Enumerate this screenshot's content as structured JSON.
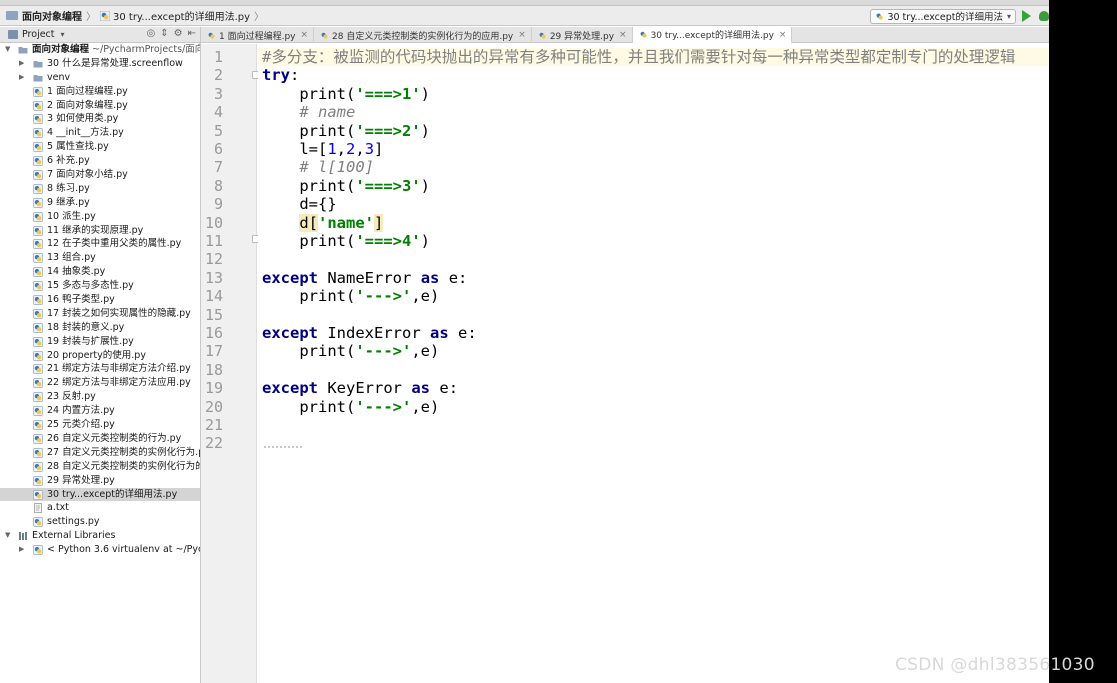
{
  "navbar": {
    "project": "面向对象编程",
    "file": "30 try...except的详细用法.py",
    "run_config": "30 try...except的详细用法"
  },
  "sidebar": {
    "header": "Project",
    "root": {
      "name": "面向对象编程",
      "path": "~/PycharmProjects/面向"
    },
    "items": [
      {
        "label": "30 什么是异常处理.screenflow",
        "kind": "folder"
      },
      {
        "label": "venv",
        "kind": "folder"
      },
      {
        "label": "1 面向过程编程.py",
        "kind": "py"
      },
      {
        "label": "2 面向对象编程.py",
        "kind": "py"
      },
      {
        "label": "3 如何使用类.py",
        "kind": "py"
      },
      {
        "label": "4 __init__方法.py",
        "kind": "py"
      },
      {
        "label": "5 属性查找.py",
        "kind": "py"
      },
      {
        "label": "6 补充.py",
        "kind": "py"
      },
      {
        "label": "7 面向对象小结.py",
        "kind": "py"
      },
      {
        "label": "8 练习.py",
        "kind": "py"
      },
      {
        "label": "9 继承.py",
        "kind": "py"
      },
      {
        "label": "10 派生.py",
        "kind": "py"
      },
      {
        "label": "11 继承的实现原理.py",
        "kind": "py"
      },
      {
        "label": "12 在子类中重用父类的属性.py",
        "kind": "py"
      },
      {
        "label": "13 组合.py",
        "kind": "py"
      },
      {
        "label": "14 抽象类.py",
        "kind": "py"
      },
      {
        "label": "15 多态与多态性.py",
        "kind": "py"
      },
      {
        "label": "16 鸭子类型.py",
        "kind": "py"
      },
      {
        "label": "17 封装之如何实现属性的隐藏.py",
        "kind": "py"
      },
      {
        "label": "18 封装的意义.py",
        "kind": "py"
      },
      {
        "label": "19 封装与扩展性.py",
        "kind": "py"
      },
      {
        "label": "20 property的使用.py",
        "kind": "py"
      },
      {
        "label": "21 绑定方法与非绑定方法介绍.py",
        "kind": "py"
      },
      {
        "label": "22 绑定方法与非绑定方法应用.py",
        "kind": "py"
      },
      {
        "label": "23 反射.py",
        "kind": "py"
      },
      {
        "label": "24 内置方法.py",
        "kind": "py"
      },
      {
        "label": "25 元类介绍.py",
        "kind": "py"
      },
      {
        "label": "26 自定义元类控制类的行为.py",
        "kind": "py"
      },
      {
        "label": "27 自定义元类控制类的实例化行为.p",
        "kind": "py"
      },
      {
        "label": "28 自定义元类控制类的实例化行为的",
        "kind": "py"
      },
      {
        "label": "29 异常处理.py",
        "kind": "py"
      },
      {
        "label": "30 try...except的详细用法.py",
        "kind": "py",
        "selected": true
      },
      {
        "label": "a.txt",
        "kind": "txt"
      },
      {
        "label": "settings.py",
        "kind": "py"
      }
    ],
    "external": "External Libraries",
    "python": "< Python 3.6 virtualenv at ~/Pycha"
  },
  "tabs": [
    {
      "label": "1 面向过程编程.py"
    },
    {
      "label": "28 自定义元类控制类的实例化行为的应用.py"
    },
    {
      "label": "29 异常处理.py"
    },
    {
      "label": "30 try...except的详细用法.py",
      "active": true
    }
  ],
  "code": {
    "l1": "#多分支：被监测的代码块抛出的异常有多种可能性，并且我们需要针对每一种异常类型都定制专门的处理逻辑",
    "kw_try": "try",
    "colon": ":",
    "print": "print",
    "s1": "'===>1'",
    "c_name": "# name",
    "s2": "'===>2'",
    "l6_a": "l=[",
    "n1": "1",
    "n2": "2",
    "n3": "3",
    "comma": ",",
    "rb": "]",
    "c_l100": "# l[100]",
    "s3": "'===>3'",
    "d_assign": "d={}",
    "d_open": "d[",
    "s_name": "'name'",
    "s4": "'===>4'",
    "kw_except": "except",
    "name_error": "NameError",
    "index_error": "IndexError",
    "key_error": "KeyError",
    "kw_as": "as",
    "e": "e",
    "s_arrow": "'--->'",
    "args_tail": ",e)",
    "lp": "(",
    "rp": ")"
  },
  "line_numbers": [
    "1",
    "2",
    "3",
    "4",
    "5",
    "6",
    "7",
    "8",
    "9",
    "10",
    "11",
    "12",
    "13",
    "14",
    "15",
    "16",
    "17",
    "18",
    "19",
    "20",
    "21",
    "22"
  ],
  "watermark": "CSDN @dhl383561030",
  "colors": {
    "keyword": "#000080",
    "string": "#008000",
    "number": "#0000ff",
    "comment": "#808080",
    "selection": "#d4d4d4",
    "brace_match": "#f6ebbc"
  }
}
